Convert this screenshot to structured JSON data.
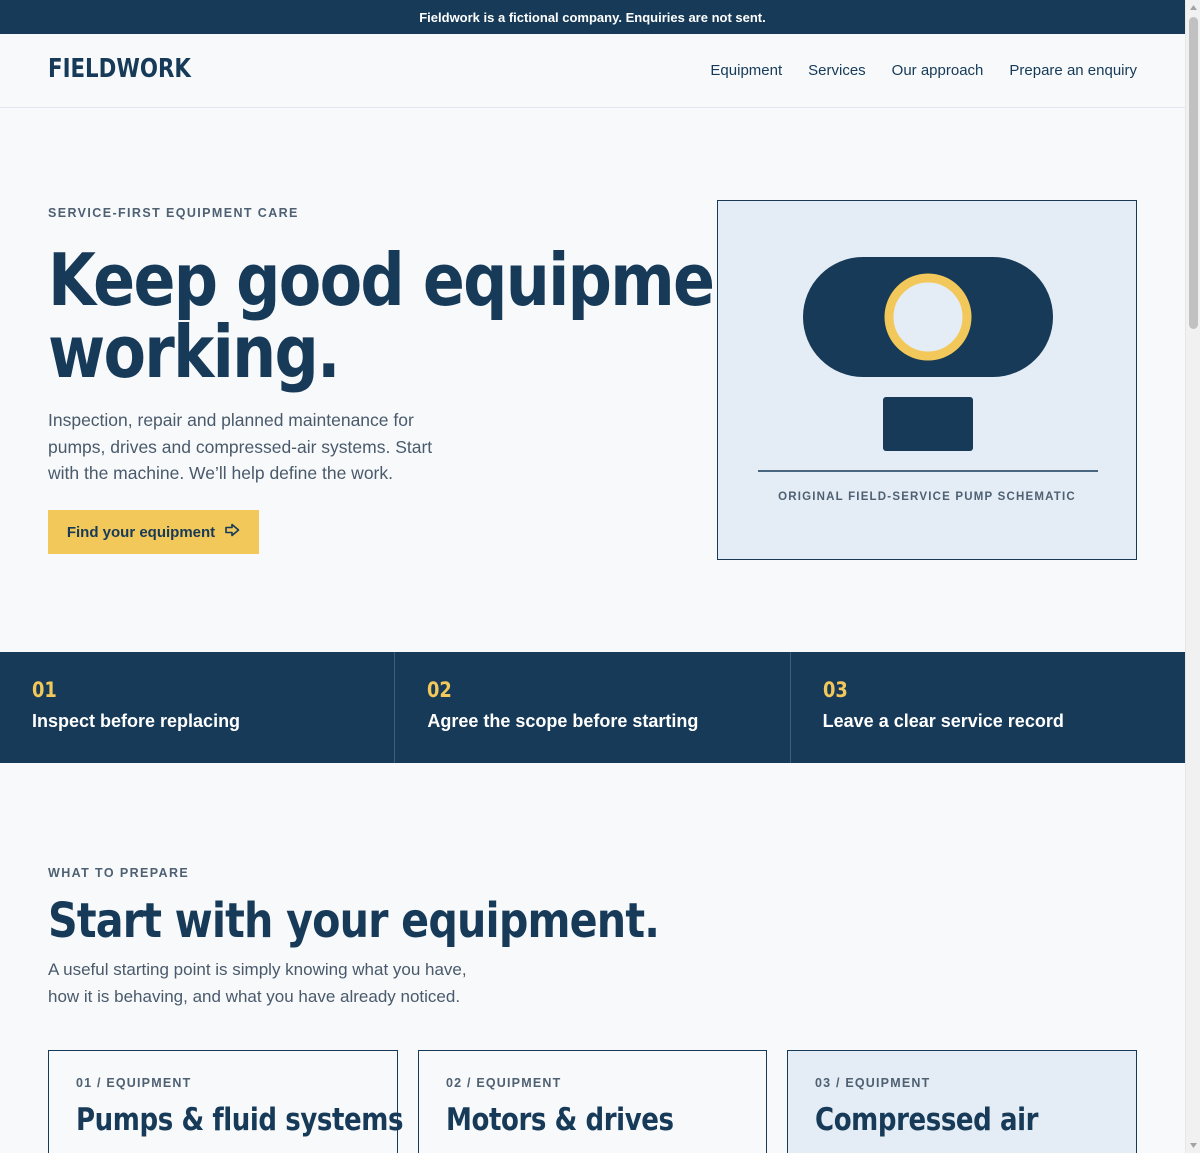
{
  "topbar": {
    "notice": "Fieldwork is a fictional company. Enquiries are not sent."
  },
  "header": {
    "logo": "FIELDWORK",
    "nav": [
      "Equipment",
      "Services",
      "Our approach",
      "Prepare an enquiry"
    ]
  },
  "hero": {
    "eyebrow": "SERVICE-FIRST EQUIPMENT CARE",
    "title_line1": "Keep good equipment",
    "title_line2": "working.",
    "text": "Inspection, repair and planned maintenance for pumps, drives and compressed-air systems. Start with the machine. We’ll help define the work.",
    "cta_label": "Find your equipment",
    "cta_icon": "arrow-right-icon",
    "illustration_caption": "ORIGINAL FIELD-SERVICE PUMP SCHEMATIC"
  },
  "principles": [
    {
      "num": "01",
      "label": "Inspect before replacing"
    },
    {
      "num": "02",
      "label": "Agree the scope before starting"
    },
    {
      "num": "03",
      "label": "Leave a clear service record"
    }
  ],
  "prepare": {
    "eyebrow": "WHAT TO PREPARE",
    "title": "Start with your equipment.",
    "text": "A useful starting point is simply knowing what you have, how it is behaving, and what you have already noticed.",
    "cards": [
      {
        "label": "01 / EQUIPMENT",
        "title": "Pumps & fluid systems"
      },
      {
        "label": "02 / EQUIPMENT",
        "title": "Motors & drives"
      },
      {
        "label": "03 / EQUIPMENT",
        "title": "Compressed air"
      }
    ]
  },
  "colors": {
    "navy": "#163a58",
    "accent_yellow": "#f3c85a",
    "background": "#f7f9fb",
    "panel": "#e4edf5"
  }
}
